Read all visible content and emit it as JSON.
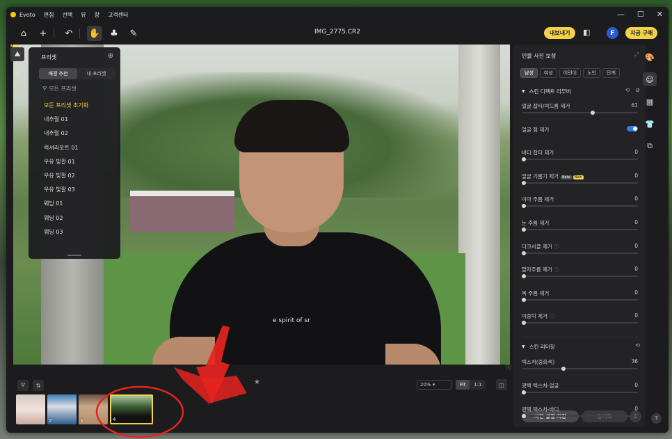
{
  "titlebar": {
    "app_name": "Evoto",
    "menu": [
      "편집",
      "선택",
      "뷰",
      "창",
      "고객센터"
    ]
  },
  "toolbar": {
    "filename": "IMG_2775.CR2",
    "export_label": "내보내기",
    "avatar_letter": "F",
    "buy_label": "지금 구매"
  },
  "left_rail": {
    "new_badge": "NEW"
  },
  "preset_panel": {
    "title": "프리셋",
    "tabs": [
      "배경 추천",
      "내 프리셋"
    ],
    "filter_label": "모든 프리셋",
    "items": [
      {
        "label": "모든 프리셋 초기화",
        "highlight": true
      },
      {
        "label": "내추럴 01"
      },
      {
        "label": "내추럴 02"
      },
      {
        "label": "럭셔리포트 01"
      },
      {
        "label": "우유 빛깔 01"
      },
      {
        "label": "우유 빛깔 02"
      },
      {
        "label": "우유 빛깔 03"
      },
      {
        "label": "웨딩 01"
      },
      {
        "label": "웨딩 02"
      },
      {
        "label": "웨딩 03"
      }
    ]
  },
  "photo": {
    "shirt_text": "e spirit of sr"
  },
  "filmstrip": {
    "zoom_value": "20%",
    "fit_label": "Fit",
    "one_to_one_label": "1:1",
    "thumbnails": [
      {
        "number": ""
      },
      {
        "number": "2"
      },
      {
        "number": "3"
      },
      {
        "number": "4",
        "selected": true
      }
    ]
  },
  "right_panel": {
    "title": "인물 사진 보정",
    "tabs": [
      {
        "label": "남성",
        "active": true
      },
      {
        "label": "여성"
      },
      {
        "label": "어린이"
      },
      {
        "label": "노인"
      },
      {
        "label": "단계"
      }
    ],
    "section1": "스킨 디펙트 리무버",
    "section2": "스킨 리터칭",
    "sliders": [
      {
        "label": "얼굴 잡티/여드름 제거",
        "value": "61",
        "fraction": 0.61
      },
      {
        "label": "얼굴 점 제거",
        "toggle": true,
        "on": true
      },
      {
        "label": "바디 잡티 제거",
        "value": "0",
        "fraction": 0
      },
      {
        "label": "얼굴 기름기 제거",
        "value": "0",
        "fraction": 0,
        "beta": "Beta",
        "new": "New"
      },
      {
        "label": "이마 주름 제거",
        "value": "0",
        "fraction": 0
      },
      {
        "label": "눈 주름 제거",
        "value": "0",
        "fraction": 0
      },
      {
        "label": "다크서클 제거",
        "value": "0",
        "fraction": 0,
        "help": true
      },
      {
        "label": "팔자주름 제거",
        "value": "0",
        "fraction": 0,
        "help": true
      },
      {
        "label": "목 주름 제거",
        "value": "0",
        "fraction": 0
      },
      {
        "label": "이중턱 제거",
        "value": "0",
        "fraction": 0,
        "help": true
      }
    ],
    "sliders2": [
      {
        "label": "텍스처(중화색)",
        "value": "36",
        "fraction": 0.36
      },
      {
        "label": "광택 텍스처-얼굴",
        "value": "0",
        "fraction": 0
      },
      {
        "label": "광택 텍스처-바디",
        "value": "0",
        "fraction": 0
      }
    ],
    "save_label": "사전 설정 저장",
    "sync_label": "동기화"
  },
  "colors": {
    "accent": "#f3d24a",
    "toggle": "#2f7ee6",
    "annotation": "#e8231f"
  }
}
